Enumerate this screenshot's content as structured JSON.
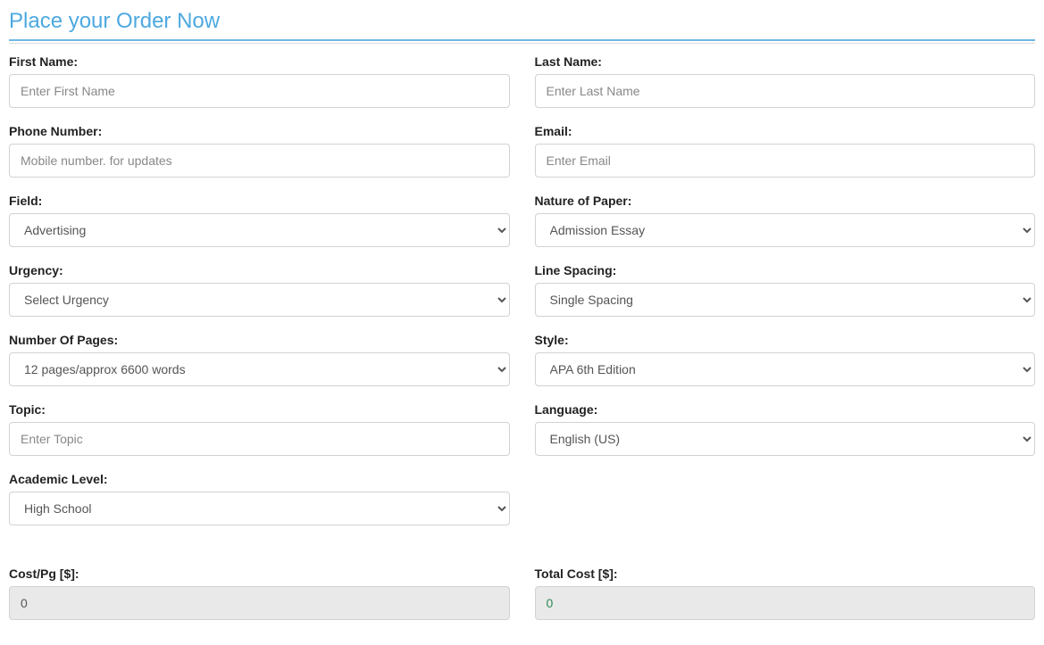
{
  "header": {
    "title": "Place your Order Now"
  },
  "form": {
    "firstName": {
      "label": "First Name:",
      "placeholder": "Enter First Name"
    },
    "lastName": {
      "label": "Last Name:",
      "placeholder": "Enter Last Name"
    },
    "phone": {
      "label": "Phone Number:",
      "placeholder": "Mobile number. for updates"
    },
    "email": {
      "label": "Email:",
      "placeholder": "Enter Email"
    },
    "field": {
      "label": "Field:",
      "selected": "Advertising"
    },
    "nature": {
      "label": "Nature of Paper:",
      "selected": "Admission Essay"
    },
    "urgency": {
      "label": "Urgency:",
      "selected": "Select Urgency"
    },
    "lineSpacing": {
      "label": "Line Spacing:",
      "selected": "Single Spacing"
    },
    "pages": {
      "label": "Number Of Pages:",
      "selected": "12 pages/approx 6600 words"
    },
    "style": {
      "label": "Style:",
      "selected": "APA 6th Edition"
    },
    "topic": {
      "label": "Topic:",
      "placeholder": "Enter Topic"
    },
    "language": {
      "label": "Language:",
      "selected": "English (US)"
    },
    "academicLevel": {
      "label": "Academic Level:",
      "selected": "High School"
    },
    "costPerPage": {
      "label": "Cost/Pg [$]:",
      "value": "0"
    },
    "totalCost": {
      "label": "Total Cost [$]:",
      "value": "0"
    }
  }
}
